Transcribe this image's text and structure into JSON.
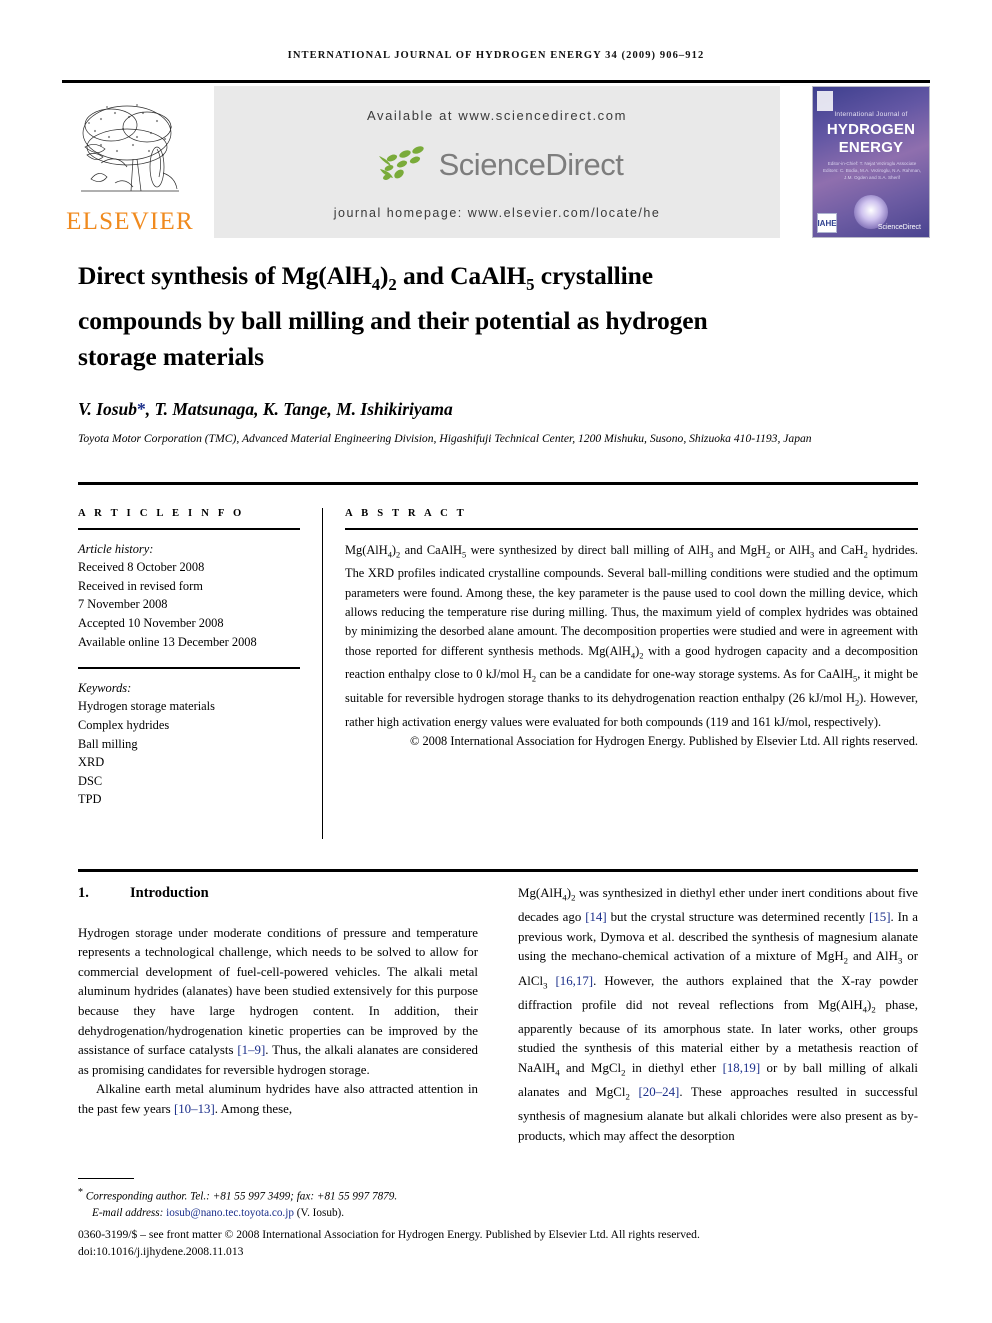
{
  "running_head": "International Journal of Hydrogen Energy 34 (2009) 906–912",
  "masthead": {
    "publisher_name": "ELSEVIER",
    "publisher_logo_icon": "elsevier-tree-logo",
    "available_at": "Available at www.sciencedirect.com",
    "sciencedirect_wordmark": "ScienceDirect",
    "sciencedirect_icon": "sciencedirect-leaves-logo",
    "journal_homepage": "journal homepage: www.elsevier.com/locate/he",
    "cover": {
      "eyebrow": "International Journal of",
      "line1": "HYDROGEN",
      "line2": "ENERGY",
      "editors": "Editor-in-Chief: T. Nejat Veziroglu    Associate Editors: C. Bodia, M.A. Veziroglu, N.A. Rahman, J.M. Ogden and S.A. Sherif",
      "badge": "IAHE",
      "footer_mark": "ScienceDirect"
    }
  },
  "colors": {
    "elsevier_orange": "#F08A1E",
    "sciencedirect_green": "#7AAB3A",
    "sciencedirect_gray": "#7d7d7d",
    "link_blue": "#1a2e8a",
    "panel_gray": "#e9e9e9"
  },
  "article": {
    "title_line1_a": "Direct synthesis of Mg(AlH",
    "title_sub1": "4",
    "title_line1_b": ")",
    "title_sub2": "2",
    "title_line1_c": " and CaAlH",
    "title_sub3": "5",
    "title_line1_d": " crystalline",
    "title_line2": "compounds by ball milling and their potential as hydrogen",
    "title_line3": "storage materials",
    "authors": "V. Iosub",
    "author_star": "*",
    "authors_rest": ", T. Matsunaga, K. Tange, M. Ishikiriyama",
    "affiliation": "Toyota Motor Corporation (TMC), Advanced Material Engineering Division, Higashifuji Technical Center, 1200 Mishuku, Susono, Shizuoka 410-1193, Japan"
  },
  "article_info": {
    "heading": "A R T I C L E   I N F O",
    "history_label": "Article history:",
    "history": [
      "Received 8 October 2008",
      "Received in revised form",
      "7 November 2008",
      "Accepted 10 November 2008",
      "Available online 13 December 2008"
    ],
    "keywords_label": "Keywords:",
    "keywords": [
      "Hydrogen storage materials",
      "Complex hydrides",
      "Ball milling",
      "XRD",
      "DSC",
      "TPD"
    ]
  },
  "abstract": {
    "heading": "A B S T R A C T",
    "copyright": "© 2008 International Association for Hydrogen Energy. Published by Elsevier Ltd. All rights reserved."
  },
  "introduction": {
    "number": "1.",
    "heading": "Introduction"
  },
  "footnote": {
    "corresponding": "Corresponding author. Tel.: +81 55 997 3499; fax: +81 55 997 7879.",
    "email_label": "E-mail address:",
    "email": "iosub@nano.tec.toyota.co.jp",
    "email_owner": "(V. Iosub).",
    "imprint_line1": "0360-3199/$ – see front matter © 2008 International Association for Hydrogen Energy. Published by Elsevier Ltd. All rights reserved.",
    "imprint_line2": "doi:10.1016/j.ijhydene.2008.11.013"
  }
}
